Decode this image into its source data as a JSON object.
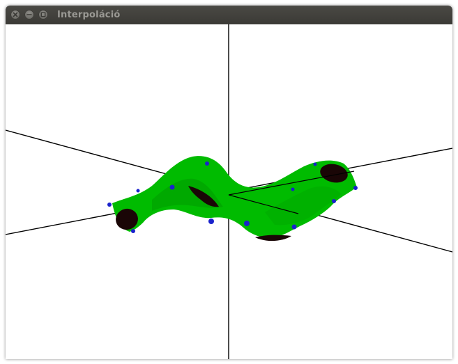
{
  "window": {
    "title": "Interpoláció",
    "buttons": [
      {
        "name": "close",
        "icon": "close-icon"
      },
      {
        "name": "minimize",
        "icon": "minimize-icon"
      },
      {
        "name": "maximize",
        "icon": "maximize-icon"
      }
    ]
  },
  "scene": {
    "background": "#ffffff",
    "axis_color": "#000000",
    "surface_color": "#00bb00",
    "hole_color": "#1a0606",
    "control_point_color": "#1a22cc"
  }
}
